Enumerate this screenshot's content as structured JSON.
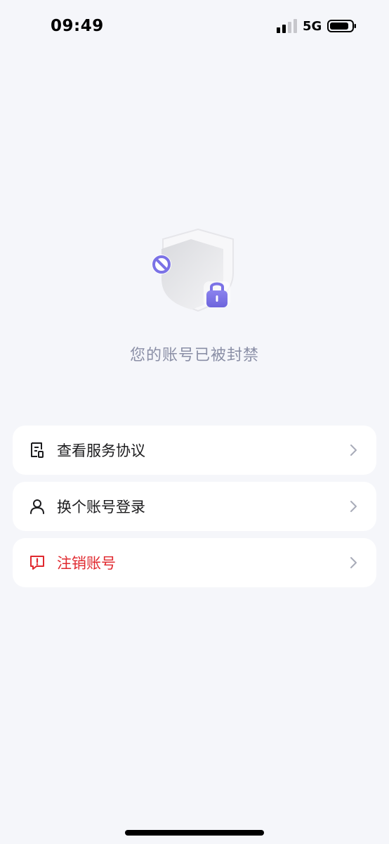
{
  "status_bar": {
    "time": "09:49",
    "network": "5G",
    "signal_icon": "signal-bars-icon",
    "battery_icon": "battery-icon"
  },
  "ban_notice": {
    "illustration_icon": "shield-lock-ban-icon",
    "title": "您的账号已被封禁"
  },
  "menu": {
    "items": [
      {
        "label": "查看服务协议",
        "icon": "document-icon"
      },
      {
        "label": "换个账号登录",
        "icon": "user-icon"
      },
      {
        "label": "注销账号",
        "icon": "alert-message-icon"
      }
    ]
  },
  "colors": {
    "background": "#f5f6fa",
    "danger": "#e0282e",
    "accent": "#7b72e6",
    "muted_text": "#8a8fa6"
  }
}
